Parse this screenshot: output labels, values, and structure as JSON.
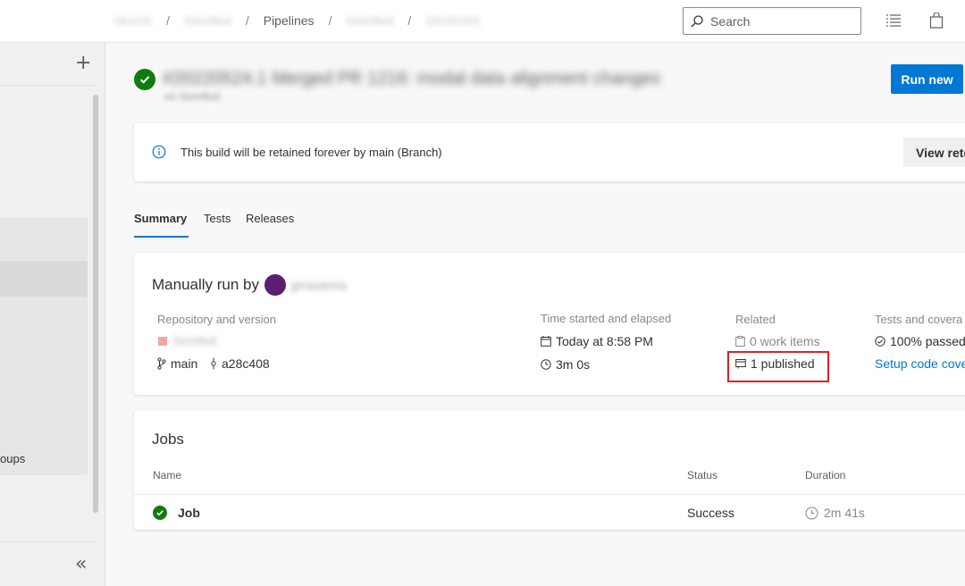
{
  "breadcrumb": {
    "items": [
      "nkmnh",
      "Gemfied",
      "Pipelines",
      "Gemfied",
      "20220201"
    ],
    "separator": "/"
  },
  "search": {
    "placeholder": "Search"
  },
  "icons": {
    "search": "search-icon",
    "list": "list-icon",
    "bag": "shopping-bag-icon",
    "plus": "plus-icon",
    "collapse": "double-chevron-left-icon",
    "info": "info-icon",
    "success": "check-circle-icon"
  },
  "leftnav": {
    "partial_label": "oups",
    "plus": "+",
    "collapse": "«"
  },
  "run": {
    "title": "#20220524.1 Merged PR 1216: modal data alignment changes",
    "subtitle": "on Gemfied",
    "status": "succeeded",
    "run_new_label": "Run new"
  },
  "banner": {
    "text": "This build will be retained forever by main (Branch)",
    "button_label": "View rete"
  },
  "tabs": [
    {
      "label": "Summary",
      "active": true
    },
    {
      "label": "Tests",
      "active": false
    },
    {
      "label": "Releases",
      "active": false
    }
  ],
  "summary": {
    "manual_prefix": "Manually run by",
    "user": "jprasanna",
    "repo": {
      "label": "Repository and version",
      "name": "Gemfied",
      "branch": "main",
      "commit": "a28c408"
    },
    "time": {
      "label": "Time started and elapsed",
      "started": "Today at 8:58 PM",
      "elapsed": "3m 0s"
    },
    "related": {
      "label": "Related",
      "work_items": "0 work items",
      "published": "1 published"
    },
    "tests": {
      "label": "Tests and covera",
      "passed": "100% passed",
      "setup_link": "Setup code cove"
    }
  },
  "jobs": {
    "title": "Jobs",
    "columns": [
      "Name",
      "Status",
      "Duration"
    ],
    "rows": [
      {
        "name": "Job",
        "status": "Success",
        "duration": "2m 41s"
      }
    ]
  },
  "colors": {
    "accent": "#0078d4",
    "success": "#107c10",
    "highlight_box": "#e02020",
    "avatar": "#5c1e6e"
  }
}
